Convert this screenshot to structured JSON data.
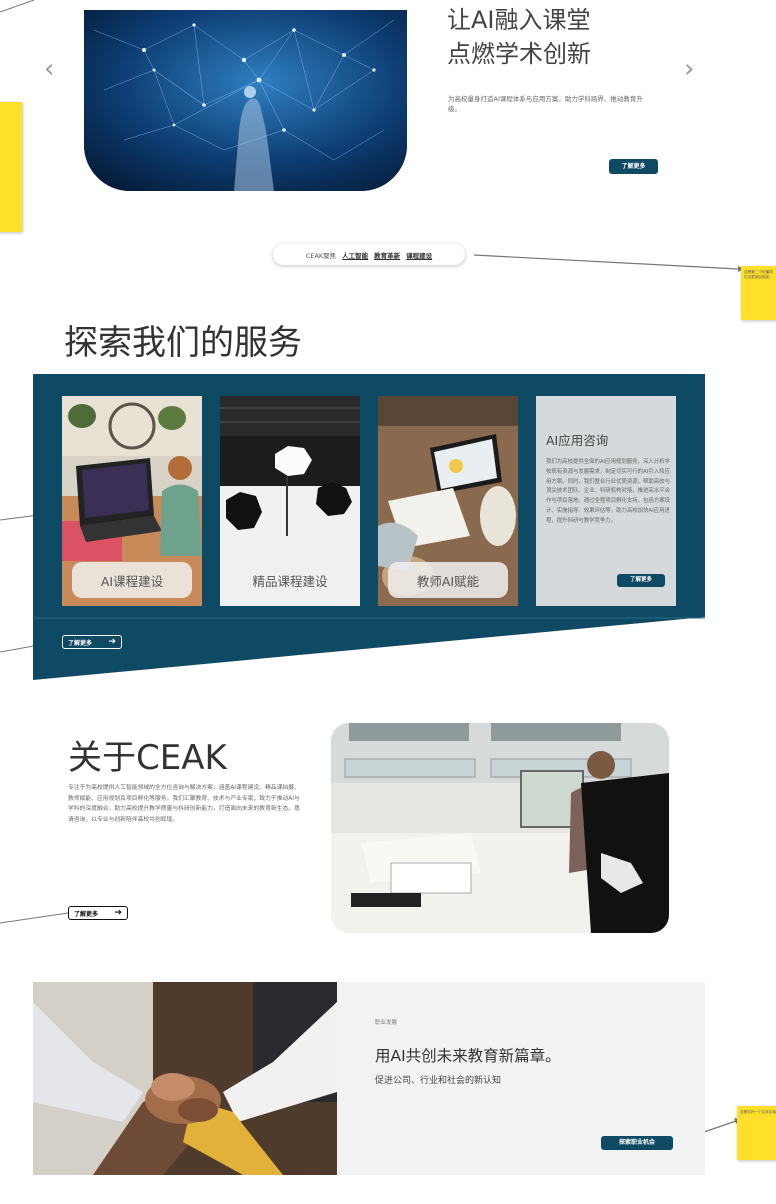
{
  "hero": {
    "title_line1": "让AI融入课堂",
    "title_line2": "点燃学术创新",
    "description": "为高校量身打造AI课程体系与应用方案，助力学科跨界、推动教育升级。",
    "cta": "了解更多",
    "prev_icon": "‹",
    "next_icon": "›"
  },
  "tag_pill": {
    "brand": "CEAK聚焦",
    "tags": [
      "人工智能",
      "教育革新",
      "课程建设"
    ]
  },
  "annotations": {
    "note_right_1": "这是第二个轮播项，在这里添加描述。",
    "note_right_2": "这是另外一个文本区域"
  },
  "services": {
    "heading": "探索我们的服务",
    "cards": [
      {
        "label": "AI课程建设"
      },
      {
        "label": "精品课程建设"
      },
      {
        "label": "教师AI赋能"
      }
    ],
    "consult": {
      "title": "AI应用咨询",
      "body": "我们为高校提供全面的AI应用规划服务，深入分析学校现有资源与发展需求，制定切实可行的AI引入和应用方案。同时，我们整合行业优质资源，帮助高校与顶尖技术团队、企业、科研机构对接，推进高水平合作与项目落地。通过全程项目孵化支持，包括方案设计、实施指导、效果评估等，助力高校加快AI应用进程，提升科研与教学竞争力。",
      "cta": "了解更多"
    },
    "more": "了解更多",
    "more_arrow": "➔"
  },
  "about": {
    "heading": "关于CEAK",
    "body": "专注于为高校提供人工智能领域的全方位咨询与解决方案，涵盖AI课程建设、精品课拍摄、教师赋能、应用规划及项目孵化等服务。我们汇聚教育、技术与产业专家，致力于推动AI与学科的深度融合，助力高校提升教学质量与科研创新能力，打造面向未来的教育新生态。恳请咨询，以专业与创新陪伴高校共创辉煌。",
    "more": "了解更多",
    "more_arrow": "➔"
  },
  "career": {
    "eyebrow": "职业发展",
    "heading": "用AI共创未来教育新篇章。",
    "subheading": "促进公司、行业和社会的新认知",
    "cta": "探索职业机会"
  },
  "colors": {
    "brand_dark": "#0f4a64",
    "note_yellow": "#fedf2a",
    "career_bg": "#f2f2f2"
  }
}
